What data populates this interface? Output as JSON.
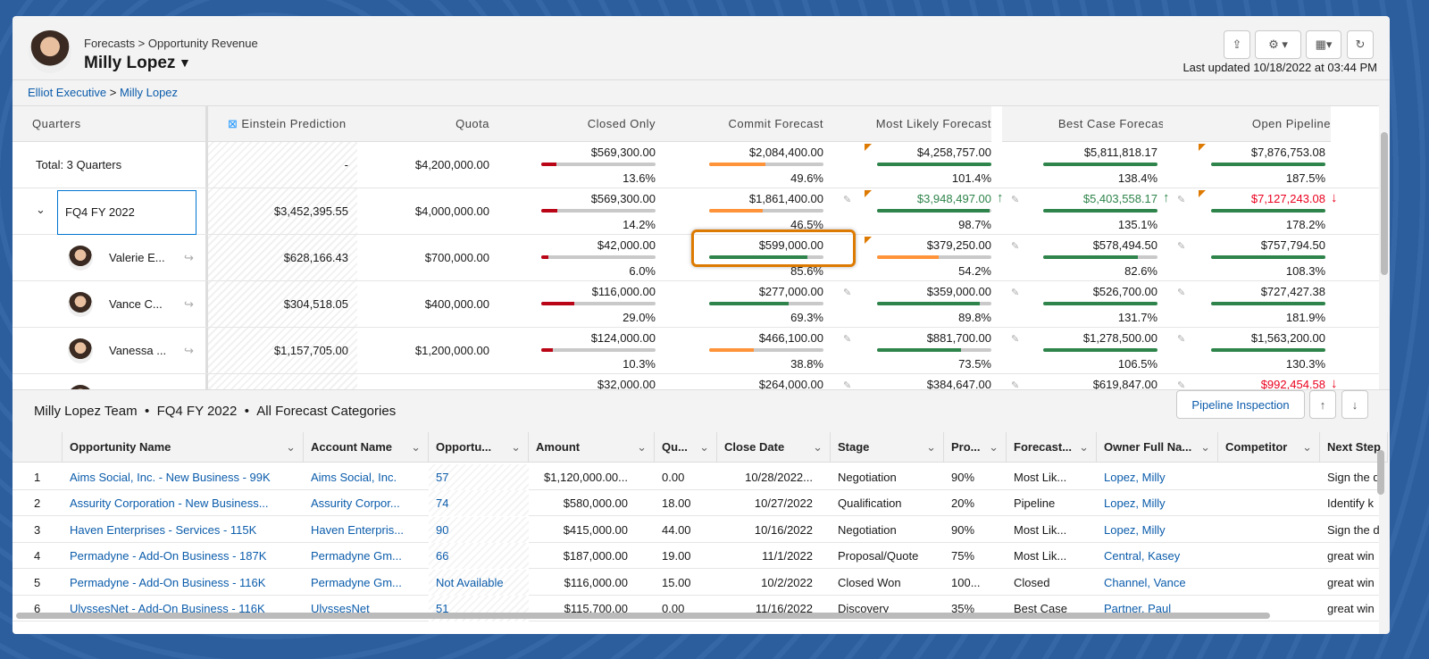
{
  "header": {
    "breadcrumb": "Forecasts > Opportunity Revenue",
    "user_name": "Milly Lopez",
    "last_updated": "Last updated 10/18/2022 at 03:44 PM"
  },
  "hierarchy": {
    "parent": "Elliot Executive",
    "separator": ">",
    "current": "Milly Lopez"
  },
  "grid": {
    "columns": [
      "Quarters",
      "Einstein Prediction",
      "Quota",
      "Closed Only",
      "Commit Forecast",
      "Most Likely Forecast",
      "Best Case Forecast",
      "Open Pipeline"
    ],
    "rows": [
      {
        "label": "Total: 3 Quarters",
        "einstein": "-",
        "quota": "$4,200,000.00",
        "cells": [
          {
            "amount": "$569,300.00",
            "pct": "13.6%",
            "fill": 0.136,
            "bar": "#ba0517"
          },
          {
            "amount": "$2,084,400.00",
            "pct": "49.6%",
            "fill": 0.496,
            "bar": "#fe9339"
          },
          {
            "amount": "$4,258,757.00",
            "pct": "101.4%",
            "fill": 1,
            "bar": "#2e844a",
            "flag": true
          },
          {
            "amount": "$5,811,818.17",
            "pct": "138.4%",
            "fill": 1,
            "bar": "#2e844a"
          },
          {
            "amount": "$7,876,753.08",
            "pct": "187.5%",
            "fill": 1,
            "bar": "#2e844a",
            "flag": true
          }
        ]
      },
      {
        "label": "FQ4 FY 2022",
        "expand": true,
        "einstein": "$3,452,395.55",
        "quota": "$4,000,000.00",
        "cells": [
          {
            "amount": "$569,300.00",
            "pct": "14.2%",
            "fill": 0.142,
            "bar": "#ba0517"
          },
          {
            "amount": "$1,861,400.00",
            "pct": "46.5%",
            "fill": 0.465,
            "bar": "#fe9339",
            "pencil": true
          },
          {
            "amount": "$3,948,497.00",
            "pct": "98.7%",
            "fill": 0.987,
            "bar": "#2e844a",
            "flag": true,
            "pencil": true,
            "color": "#2e844a",
            "arrow": "↑"
          },
          {
            "amount": "$5,403,558.17",
            "pct": "135.1%",
            "fill": 1,
            "bar": "#2e844a",
            "pencil": true,
            "color": "#2e844a",
            "arrow": "↑"
          },
          {
            "amount": "$7,127,243.08",
            "pct": "178.2%",
            "fill": 1,
            "bar": "#2e844a",
            "flag": true,
            "color": "#ea001e",
            "arrow": "↓"
          }
        ]
      },
      {
        "label": "Valerie E...",
        "avatar": true,
        "einstein": "$628,166.43",
        "quota": "$700,000.00",
        "cells": [
          {
            "amount": "$42,000.00",
            "pct": "6.0%",
            "fill": 0.06,
            "bar": "#ba0517"
          },
          {
            "amount": "$599,000.00",
            "pct": "85.6%",
            "fill": 0.856,
            "bar": "#2e844a",
            "highlight": true
          },
          {
            "amount": "$379,250.00",
            "pct": "54.2%",
            "fill": 0.542,
            "bar": "#fe9339",
            "flag": true,
            "pencil": true
          },
          {
            "amount": "$578,494.50",
            "pct": "82.6%",
            "fill": 0.826,
            "bar": "#2e844a",
            "pencil": true
          },
          {
            "amount": "$757,794.50",
            "pct": "108.3%",
            "fill": 1,
            "bar": "#2e844a"
          }
        ]
      },
      {
        "label": "Vance C...",
        "avatar": true,
        "einstein": "$304,518.05",
        "quota": "$400,000.00",
        "cells": [
          {
            "amount": "$116,000.00",
            "pct": "29.0%",
            "fill": 0.29,
            "bar": "#ba0517"
          },
          {
            "amount": "$277,000.00",
            "pct": "69.3%",
            "fill": 0.693,
            "bar": "#2e844a",
            "pencil": true
          },
          {
            "amount": "$359,000.00",
            "pct": "89.8%",
            "fill": 0.898,
            "bar": "#2e844a",
            "pencil": true
          },
          {
            "amount": "$526,700.00",
            "pct": "131.7%",
            "fill": 1,
            "bar": "#2e844a",
            "pencil": true
          },
          {
            "amount": "$727,427.38",
            "pct": "181.9%",
            "fill": 1,
            "bar": "#2e844a"
          }
        ]
      },
      {
        "label": "Vanessa ...",
        "avatar": true,
        "einstein": "$1,157,705.00",
        "quota": "$1,200,000.00",
        "cells": [
          {
            "amount": "$124,000.00",
            "pct": "10.3%",
            "fill": 0.103,
            "bar": "#ba0517"
          },
          {
            "amount": "$466,100.00",
            "pct": "38.8%",
            "fill": 0.388,
            "bar": "#fe9339",
            "pencil": true
          },
          {
            "amount": "$881,700.00",
            "pct": "73.5%",
            "fill": 0.735,
            "bar": "#2e844a",
            "pencil": true
          },
          {
            "amount": "$1,278,500.00",
            "pct": "106.5%",
            "fill": 1,
            "bar": "#2e844a",
            "pencil": true
          },
          {
            "amount": "$1,563,200.00",
            "pct": "130.3%",
            "fill": 1,
            "bar": "#2e844a"
          }
        ]
      },
      {
        "label": "",
        "avatar": true,
        "einstein": "",
        "quota": "",
        "cells": [
          {
            "amount": "$32,000.00"
          },
          {
            "amount": "$264,000.00",
            "pencil": true
          },
          {
            "amount": "$384,647.00",
            "pencil": true
          },
          {
            "amount": "$619,847.00",
            "pencil": true
          },
          {
            "amount": "$992,454.58",
            "color": "#ea001e",
            "arrow": "↓"
          }
        ]
      }
    ]
  },
  "detail": {
    "title": [
      "Milly Lopez Team",
      "FQ4 FY 2022",
      "All Forecast Categories"
    ],
    "bullet": "•",
    "pipeline_button": "Pipeline Inspection",
    "columns": [
      "Opportunity Name",
      "Account Name",
      "Opportu...",
      "Amount",
      "Qu...",
      "Close Date",
      "Stage",
      "Pro...",
      "Forecast...",
      "Owner Full Na...",
      "Competitor",
      "Next Step"
    ],
    "rows": [
      [
        "1",
        "Aims Social, Inc. - New Business - 99K",
        "Aims Social, Inc.",
        "57",
        "$1,120,000.00...",
        "0.00",
        "10/28/2022...",
        "Negotiation",
        "90%",
        "Most Lik...",
        "Lopez, Milly",
        "",
        "Sign the d"
      ],
      [
        "2",
        "Assurity Corporation - New Business...",
        "Assurity Corpor...",
        "74",
        "$580,000.00",
        "18.00",
        "10/27/2022",
        "Qualification",
        "20%",
        "Pipeline",
        "Lopez, Milly",
        "",
        "Identify k"
      ],
      [
        "3",
        "Haven Enterprises - Services - 115K",
        "Haven Enterpris...",
        "90",
        "$415,000.00",
        "44.00",
        "10/16/2022",
        "Negotiation",
        "90%",
        "Most Lik...",
        "Lopez, Milly",
        "",
        "Sign the d"
      ],
      [
        "4",
        "Permadyne - Add-On Business - 187K",
        "Permadyne Gm...",
        "66",
        "$187,000.00",
        "19.00",
        "11/1/2022",
        "Proposal/Quote",
        "75%",
        "Most Lik...",
        "Central, Kasey",
        "",
        "great win"
      ],
      [
        "5",
        "Permadyne - Add-On Business - 116K",
        "Permadyne Gm...",
        "Not Available",
        "$116,000.00",
        "15.00",
        "10/2/2022",
        "Closed Won",
        "100...",
        "Closed",
        "Channel, Vance",
        "",
        "great win"
      ],
      [
        "6",
        "UlyssesNet - Add-On Business - 116K",
        "UlyssesNet",
        "51",
        "$115,700.00",
        "0.00",
        "11/16/2022",
        "Discovery",
        "35%",
        "Best Case",
        "Partner, Paul",
        "",
        "great win"
      ]
    ]
  }
}
